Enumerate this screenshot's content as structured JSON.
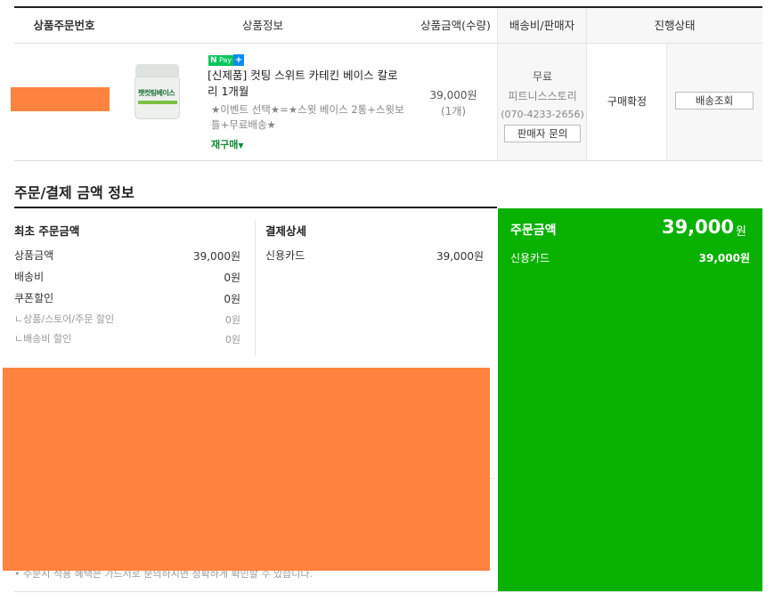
{
  "table": {
    "headers": {
      "order_no": "상품주문번호",
      "product_info": "상품정보",
      "price_qty": "상품금액(수량)",
      "shipping_seller": "배송비/판매자",
      "status": "진행상태"
    },
    "row": {
      "product_image_label": "팻컷팅베이스",
      "npay_badge": {
        "n": "N",
        "pay": "Pay",
        "plus": "+"
      },
      "product_title": "[신제품] 컷팅 스위트 카테킨 베이스 칼로리 1개월",
      "product_option": "★이벤트 선택★=★스윗 베이스 2통+스윗보틀+무료배송★",
      "rebuy_link": "재구매",
      "price": "39,000원",
      "quantity": "(1개)",
      "shipping_fee": "무료",
      "seller_name": "피트니스스토리",
      "seller_phone": "(070-4233-2656)",
      "seller_inquiry_button": "판매자 문의",
      "status_text": "구매확정",
      "shipping_lookup_button": "배송조회"
    }
  },
  "payment": {
    "section_title": "주문/결제 금액 정보",
    "original": {
      "title": "최초 주문금액",
      "lines": [
        {
          "label": "상품금액",
          "value": "39,000원"
        },
        {
          "label": "배송비",
          "value": "0원"
        },
        {
          "label": "쿠폰할인",
          "value": "0원"
        }
      ],
      "sub_lines": [
        {
          "label": "ㄴ상품/스토어/주문 할인",
          "value": "0원"
        },
        {
          "label": "ㄴ배송비 할인",
          "value": "0원"
        }
      ]
    },
    "detail": {
      "title": "결제상세",
      "method": "신용카드",
      "amount": "39,000원"
    },
    "summary": {
      "title": "주문금액",
      "total": "39,000",
      "unit": "원",
      "method": "신용카드",
      "method_amount": "39,000원"
    },
    "note": "• 주문시 적용 혜택은 가드서로 문의하시면 정확하게 확인할 수 있습니다."
  },
  "colors": {
    "accent_green": "#09b100",
    "npay_green": "#03c75a",
    "redaction": "#fe833e"
  }
}
